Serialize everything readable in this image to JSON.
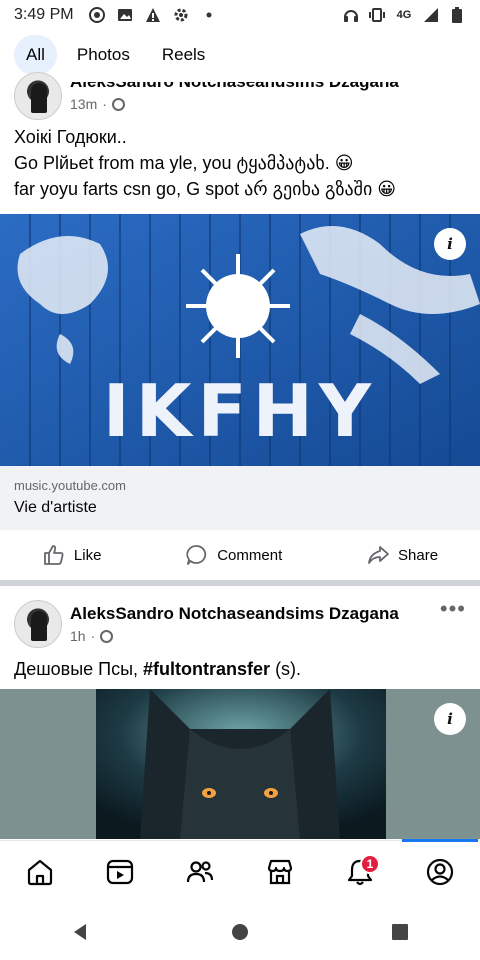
{
  "status_bar": {
    "time": "3:49 PM",
    "left_icons": [
      "record-icon",
      "image-icon",
      "warning-icon",
      "gear-icon",
      "dot-icon"
    ],
    "right_icons": [
      "headphones-icon",
      "vibrate-icon",
      "network-4g-icon",
      "signal-icon",
      "battery-icon"
    ],
    "network_label": "4G"
  },
  "tabs": [
    {
      "label": "All",
      "active": true
    },
    {
      "label": "Photos",
      "active": false
    },
    {
      "label": "Reels",
      "active": false
    }
  ],
  "post1": {
    "author": "AleksSandro Notchaseandsims Dzagana",
    "time": "13m",
    "text_lines": [
      "Хоікі Годюки..",
      "Go Plйьet from ma yle, you ტყამპატახ. 😀",
      "far yoyu farts csn go, G spot არ გეიხა გზაში 😀"
    ],
    "media_text": "IKFHY",
    "link_domain": "music.youtube.com",
    "link_title": "Vie d'artiste",
    "info_label": "i",
    "actions": [
      {
        "label": "Like",
        "icon": "thumbs-up-icon"
      },
      {
        "label": "Comment",
        "icon": "comment-icon"
      },
      {
        "label": "Share",
        "icon": "share-icon"
      }
    ]
  },
  "post2": {
    "author": "AleksSandro Notchaseandsims Dzagana",
    "time": "1h",
    "text_prefix": "Дешовые Псы, ",
    "hashtag": "#fultontransfer",
    "text_suffix": " (s).",
    "more_label": "•••",
    "info_label": "i"
  },
  "bottom_nav": {
    "items": [
      "home-icon",
      "video-icon",
      "friends-icon",
      "marketplace-icon",
      "notifications-icon",
      "profile-icon"
    ],
    "notification_count": "1",
    "active": "profile-icon"
  },
  "colors": {
    "accent": "#1877f2",
    "tab_active_bg": "#e7f0fd",
    "badge": "#e41e3f",
    "secondary_text": "#65676b"
  }
}
